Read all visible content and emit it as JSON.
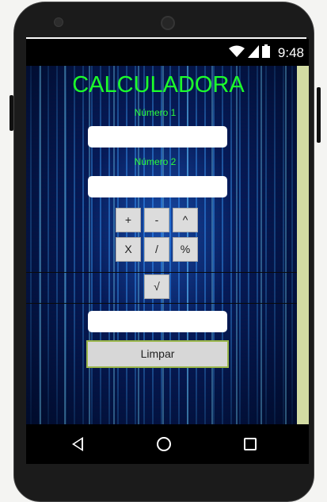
{
  "status_bar": {
    "time": "9:48",
    "icons": [
      "wifi-icon",
      "signal-icon",
      "battery-icon"
    ]
  },
  "app": {
    "title": "CALCULADORA",
    "label_number1": "Número 1",
    "label_number2": "Número 2",
    "input_number1": "",
    "input_number2": "",
    "result": ""
  },
  "operators": {
    "row1": [
      "+",
      "-",
      "^"
    ],
    "row2": [
      "X",
      "/",
      "%"
    ],
    "sqrt": "√"
  },
  "clear_label": "Limpar",
  "colors": {
    "title": "#1cff2a",
    "background": "#06123a",
    "side_strip": "#d3dca3"
  }
}
